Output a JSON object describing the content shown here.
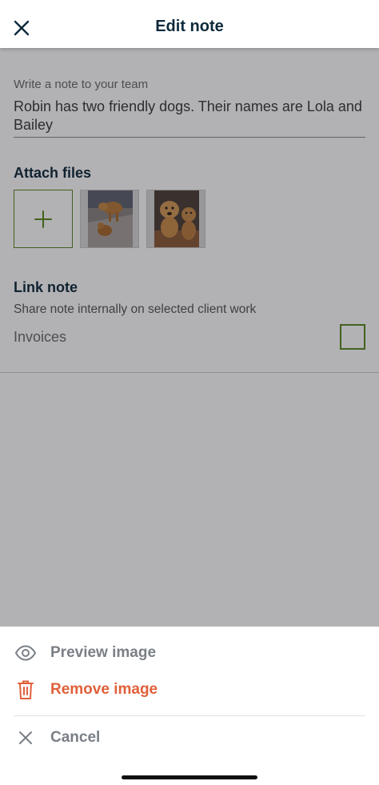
{
  "header": {
    "title": "Edit note",
    "close_icon": "close-icon"
  },
  "note": {
    "label": "Write a note to your team",
    "value": "Robin has two friendly dogs. Their names are Lola and Bailey"
  },
  "attach": {
    "title": "Attach files",
    "add_icon": "plus-icon",
    "thumbnails": [
      {
        "subject": "dog photo 1"
      },
      {
        "subject": "dog photo 2"
      }
    ]
  },
  "link": {
    "title": "Link note",
    "subtitle": "Share note internally on selected client work",
    "option_label": "Invoices",
    "option_checked": false
  },
  "sheet": {
    "preview_label": "Preview image",
    "remove_label": "Remove image",
    "cancel_label": "Cancel"
  },
  "colors": {
    "primary_text": "#0e2a3b",
    "accent_green": "#5a8a1e",
    "destructive_red": "#e0603a",
    "muted_gray": "#7a7f86"
  }
}
